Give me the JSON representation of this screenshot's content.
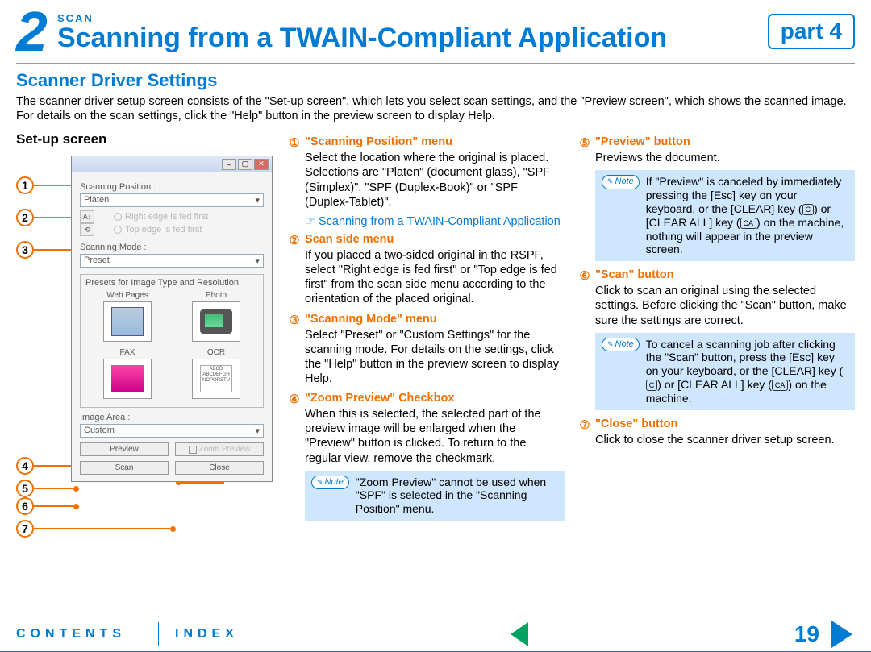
{
  "header": {
    "chapter_num": "2",
    "category": "SCAN",
    "title": "Scanning from a TWAIN-Compliant Application",
    "part": "part 4"
  },
  "section_title": "Scanner Driver Settings",
  "intro": "The scanner driver setup screen consists of the \"Set-up screen\", which lets you select scan settings, and the \"Preview screen\", which shows the scanned image. For details on the scan settings, click the \"Help\" button in the preview screen to display Help.",
  "setup_label": "Set-up screen",
  "window": {
    "scanning_position_label": "Scanning Position :",
    "scanning_position_value": "Platen",
    "radio1": "Right edge is fed first",
    "radio2": "Top edge is fed first",
    "scanning_mode_label": "Scanning Mode :",
    "scanning_mode_value": "Preset",
    "presets_label": "Presets for Image Type and Resolution:",
    "preset_webpages": "Web Pages",
    "preset_photo": "Photo",
    "preset_fax": "FAX",
    "preset_ocr": "OCR",
    "preset_ocr_sample": "ABCD\nABCDEFGH\nNOPQRSTU",
    "image_area_label": "Image Area :",
    "image_area_value": "Custom",
    "btn_preview": "Preview",
    "btn_zoom": "Zoom Preview",
    "btn_scan": "Scan",
    "btn_close": "Close"
  },
  "items": {
    "i1": {
      "num": "1",
      "title": "\"Scanning Position\" menu",
      "text": "Select the location where the original is placed. Selections are \"Platen\" (document glass), \"SPF (Simplex)\", \"SPF (Duplex-Book)\" or \"SPF (Duplex-Tablet)\".",
      "xref": "Scanning from a TWAIN-Compliant Application"
    },
    "i2": {
      "num": "2",
      "title": "Scan side menu",
      "text": "If you placed a two-sided original in the RSPF, select \"Right edge is fed first\" or \"Top edge is fed first\" from the scan side menu according to the orientation of the placed original."
    },
    "i3": {
      "num": "3",
      "title": "\"Scanning Mode\" menu",
      "text": "Select \"Preset\" or \"Custom Settings\" for the scanning mode. For details on the settings, click the \"Help\" button in the preview screen to display Help."
    },
    "i4": {
      "num": "4",
      "title": "\"Zoom Preview\" Checkbox",
      "text": "When this is selected, the selected part of the preview image will be enlarged when the \"Preview\" button is clicked. To return to the regular view, remove the checkmark.",
      "note": "\"Zoom Preview\" cannot be used when \"SPF\" is selected in the \"Scanning Position\" menu."
    },
    "i5": {
      "num": "5",
      "title": "\"Preview\" button",
      "text": "Previews the document.",
      "note_pre": "If \"Preview\" is canceled by immediately pressing the [Esc] key on your keyboard, or the [CLEAR] key (",
      "note_mid": ") or [CLEAR ALL] key (",
      "note_post": ") on the machine, nothing will appear in the preview screen.",
      "key_c": "C",
      "key_ca": "CA"
    },
    "i6": {
      "num": "6",
      "title": "\"Scan\" button",
      "text": "Click to scan an original using the selected settings. Before clicking the \"Scan\" button, make sure the settings are correct.",
      "note_pre": "To cancel a scanning job after clicking the \"Scan\" button, press the [Esc] key on your keyboard, or the [CLEAR] key (",
      "note_mid": ") or [CLEAR ALL] key (",
      "note_post": ") on the machine.",
      "key_c": "C",
      "key_ca": "CA"
    },
    "i7": {
      "num": "7",
      "title": "\"Close\" button",
      "text": "Click to close the scanner driver setup screen."
    }
  },
  "note_label": "Note",
  "footer": {
    "contents": "CONTENTS",
    "index": "INDEX",
    "page": "19"
  }
}
